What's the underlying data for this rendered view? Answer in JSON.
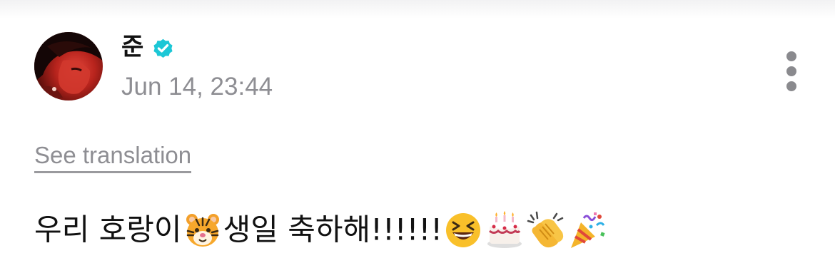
{
  "post": {
    "author": {
      "name": "준",
      "verified": true,
      "verified_color": "#1cc7d6"
    },
    "timestamp": "Jun 14, 23:44",
    "translate_label": "See translation",
    "text_parts": {
      "part1": "우리 호랑이",
      "part2": "생일 축하해!!!!!!"
    },
    "emojis": [
      "tiger-face",
      "grinning-squinting-face",
      "birthday-cake",
      "clapping-hands",
      "party-popper"
    ],
    "more_icon": "more-vertical-icon"
  }
}
